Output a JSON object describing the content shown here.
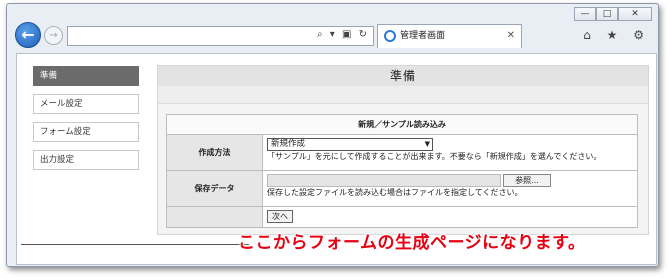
{
  "browser": {
    "window_controls": [
      "—",
      "□",
      "✕"
    ],
    "tab_title": "管理者画面",
    "tab_close": "✕",
    "address_icons": "⌕ ▾ ▣ ↻",
    "right_icons": "⌂ ★ ⚙",
    "back_glyph": "←",
    "forward_glyph": "→"
  },
  "sidebar": {
    "items": [
      {
        "label": "準備",
        "active": true
      },
      {
        "label": "メール設定",
        "active": false
      },
      {
        "label": "フォーム設定",
        "active": false
      },
      {
        "label": "出力設定",
        "active": false
      }
    ]
  },
  "main": {
    "title": "準備",
    "form": {
      "heading": "新規／サンプル読み込み",
      "rows": {
        "method": {
          "label": "作成方法",
          "selected": "新規作成",
          "help": "「サンプル」を元にして作成することが出来ます。不要なら「新規作成」を選んでください。"
        },
        "saved": {
          "label": "保存データ",
          "browse_label": "参照...",
          "help": "保存した設定ファイルを読み込む場合はファイルを指定してください。"
        }
      },
      "next_label": "次へ"
    }
  },
  "caption": "ここからフォームの生成ページになります。"
}
